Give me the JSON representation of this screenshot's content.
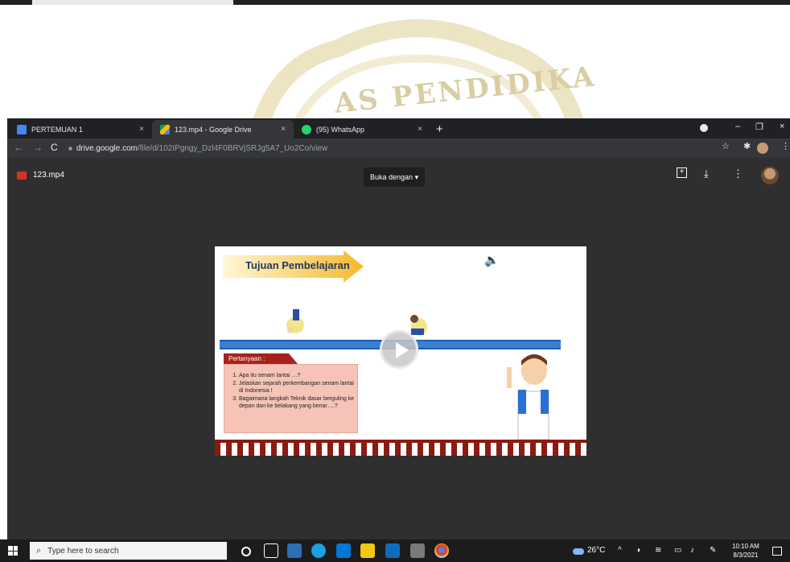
{
  "watermark": {
    "text": "PENDIDIKA",
    "prefix": "AS"
  },
  "tabs": [
    {
      "label": "PERTEMUAN 1",
      "close": "×",
      "favicon_color": "#4285f4"
    },
    {
      "label": "123.mp4 - Google Drive",
      "close": "×",
      "favicon_color": "#fbbc04"
    },
    {
      "label": "(95) WhatsApp",
      "close": "×",
      "favicon_color": "#25d366"
    }
  ],
  "new_tab_label": "+",
  "window_controls": {
    "minimize": "–",
    "restore": "❐",
    "close": "×"
  },
  "address": {
    "host": "drive.google.com",
    "path": "/file/d/102IPgngy_Dzl4F0BRVjSRJg5A7_Uo2Co/view"
  },
  "viewer": {
    "file_name": "123.mp4",
    "open_with": "Buka dengan",
    "open_with_caret": "▾"
  },
  "slide": {
    "title": "Tujuan Pembelajaran",
    "question_header": "Pertanyaan :",
    "questions": [
      "Apa itu senam lantai …?",
      "Jelaskan sejarah perkembangan senam lantai di Indonesia !",
      "Bagaimana langkah Teknik dasar berguling ke depan dan ke belakang yang benar….?"
    ]
  },
  "taskbar": {
    "search_placeholder": "Type here to search",
    "weather": "26°C",
    "time": "10:10 AM",
    "date": "8/3/2021"
  }
}
